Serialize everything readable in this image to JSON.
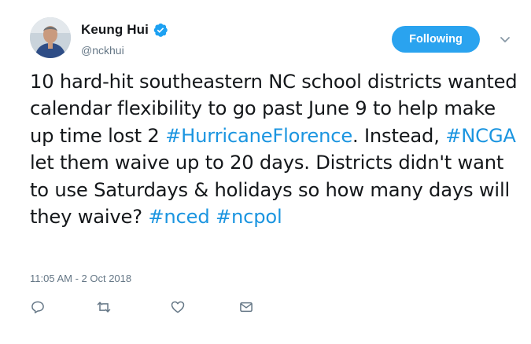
{
  "author": {
    "display_name": "Keung Hui",
    "handle": "@nckhui",
    "verified_icon": "verified-badge-icon",
    "avatar_icon": "avatar"
  },
  "follow_button": {
    "label": "Following"
  },
  "menu_icon": "chevron-down-icon",
  "tweet": {
    "segments": [
      {
        "text": "10 hard-hit southeastern NC school districts wanted calendar flexibility to go past June 9 to help make up time lost 2 ",
        "type": "text"
      },
      {
        "text": "#HurricaneFlorence",
        "type": "hashtag"
      },
      {
        "text": ". Instead, ",
        "type": "text"
      },
      {
        "text": "#NCGA",
        "type": "hashtag"
      },
      {
        "text": " let them waive up to 20 days. Districts didn't want to use Saturdays & holidays so how many days will they waive? ",
        "type": "text"
      },
      {
        "text": "#nced",
        "type": "hashtag"
      },
      {
        "text": " ",
        "type": "text"
      },
      {
        "text": "#ncpol",
        "type": "hashtag"
      }
    ]
  },
  "timestamp": "11:05 AM - 2 Oct 2018",
  "actions": [
    {
      "name": "reply-icon"
    },
    {
      "name": "retweet-icon"
    },
    {
      "name": "like-icon"
    },
    {
      "name": "direct-message-icon"
    }
  ],
  "colors": {
    "accent": "#1b95e0",
    "button": "#2aa3ef",
    "muted": "#657786",
    "text": "#14171a"
  }
}
